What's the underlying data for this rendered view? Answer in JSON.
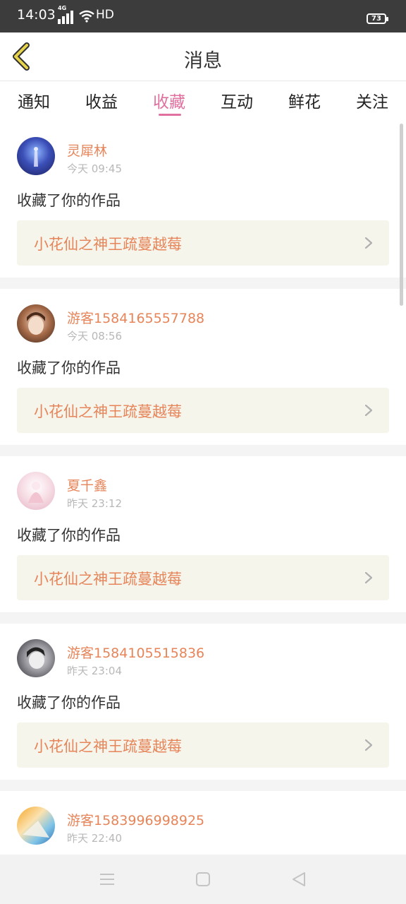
{
  "status_bar": {
    "time": "14:03",
    "network": "4G",
    "hd": "HD",
    "battery": "73"
  },
  "header": {
    "title": "消息",
    "back_icon": "chevron-left-icon"
  },
  "tabs": [
    {
      "label": "通知",
      "active": false
    },
    {
      "label": "收益",
      "active": false
    },
    {
      "label": "收藏",
      "active": true
    },
    {
      "label": "互动",
      "active": false
    },
    {
      "label": "鲜花",
      "active": false
    },
    {
      "label": "关注",
      "active": false
    }
  ],
  "items": [
    {
      "username": "灵犀林",
      "time": "今天 09:45",
      "action": "收藏了你的作品",
      "work": "小花仙之神王疏蔓越莓"
    },
    {
      "username": "游客1584165557788",
      "time": "今天 08:56",
      "action": "收藏了你的作品",
      "work": "小花仙之神王疏蔓越莓"
    },
    {
      "username": "夏千鑫",
      "time": "昨天 23:12",
      "action": "收藏了你的作品",
      "work": "小花仙之神王疏蔓越莓"
    },
    {
      "username": "游客1584105515836",
      "time": "昨天 23:04",
      "action": "收藏了你的作品",
      "work": "小花仙之神王疏蔓越莓"
    },
    {
      "username": "游客1583996998925",
      "time": "昨天 22:40",
      "action": "",
      "work": ""
    }
  ],
  "colors": {
    "accent_pink": "#e0709f",
    "name_orange": "#e6855a",
    "back_arrow_yellow": "#e8d44a"
  },
  "navbar": {
    "menu_icon": "menu-icon",
    "home_icon": "home-square-icon",
    "back_icon": "back-triangle-icon"
  }
}
